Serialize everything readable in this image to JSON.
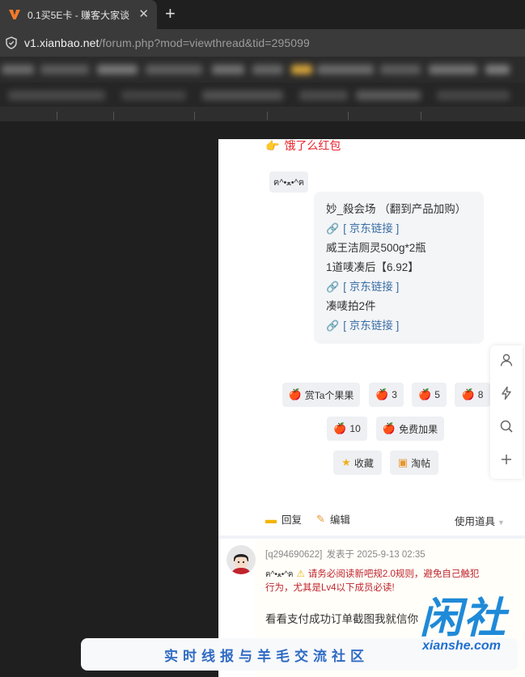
{
  "browser": {
    "tab_title": "0.1买5E卡 - 赚客大家谈",
    "close_glyph": "✕",
    "new_tab_glyph": "+",
    "url_host": "v1.xianbao.net",
    "url_path": "/forum.php?mod=viewthread&tid=295099"
  },
  "post": {
    "eleme_link": "饿了么红包",
    "emoticon": "ฅ^•ﻌ•^ฅ",
    "bubble_lines": [
      {
        "type": "text",
        "text": "妙_殺会场 （翻到产品加购）"
      },
      {
        "type": "link",
        "text": "[ 京东链接 ]"
      },
      {
        "type": "text",
        "text": "威王洁厕灵500g*2瓶"
      },
      {
        "type": "text",
        "text": "1道唛凑后【6.92】"
      },
      {
        "type": "link",
        "text": "[ 京东链接 ]"
      },
      {
        "type": "text",
        "text": "凑唛拍2件"
      },
      {
        "type": "link",
        "text": "[ 京东链接 ]"
      }
    ],
    "buttons": {
      "reward": "赏Ta个果果",
      "v3": "3",
      "v5": "5",
      "v8": "8",
      "v10": "10",
      "free": "免费加果",
      "favorite": "收藏",
      "tao": "淘帖"
    },
    "actions": {
      "reply": "回复",
      "edit": "编辑",
      "tools": "使用道具"
    }
  },
  "post2": {
    "author": "[q294690622]",
    "posted": "发表于 2025-9-13 02:35",
    "emoticon": "ฅ^•ﻌ•^ฅ",
    "notice_line1": "请务必阅读新吧规2.0规则，避免自己触犯",
    "notice_line2": "行为，尤其是Lv4以下成员必读!",
    "reply_text": "看看支付成功订单截图我就信你"
  },
  "watermark": {
    "banner": "实时线报与羊毛交流社区",
    "logo": "闲社",
    "domain": "xianshe.com"
  },
  "colors": {
    "link": "#3a6ea5",
    "red": "#e8262e",
    "brand_blue": "#1f8ad8"
  },
  "icons": [
    "brand-v-icon",
    "shield-icon",
    "hand-point-icon",
    "paperclip-icon",
    "apple-icon",
    "star-icon",
    "box-icon",
    "user-icon",
    "lightning-icon",
    "search-icon",
    "plus-icon",
    "qrcode-icon",
    "bell-icon",
    "chat-bubble-icon",
    "pencil-icon"
  ]
}
